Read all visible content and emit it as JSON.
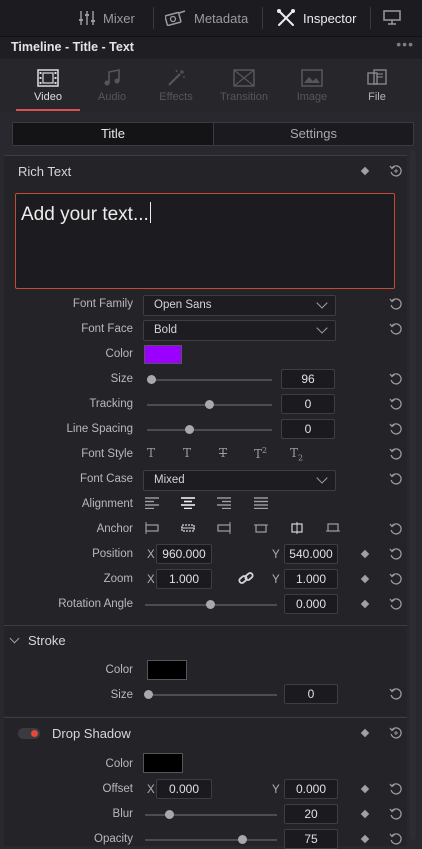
{
  "topbar": {
    "mixer": "Mixer",
    "metadata": "Metadata",
    "inspector": "Inspector"
  },
  "titlebar": {
    "title": "Timeline - Title - Text",
    "menu": "•••"
  },
  "tabs": [
    {
      "label": "Video",
      "icon": "film-icon",
      "active": true
    },
    {
      "label": "Audio",
      "icon": "music-icon",
      "active": false
    },
    {
      "label": "Effects",
      "icon": "magic-wand-icon",
      "active": false
    },
    {
      "label": "Transition",
      "icon": "transition-icon",
      "active": false
    },
    {
      "label": "Image",
      "icon": "image-icon",
      "active": false
    },
    {
      "label": "File",
      "icon": "file-icon",
      "active": false
    }
  ],
  "subtabs": {
    "title": "Title",
    "settings": "Settings"
  },
  "rich_text": {
    "heading": "Rich Text",
    "text_placeholder": "Add your text...",
    "font_family_label": "Font Family",
    "font_family_value": "Open Sans",
    "font_face_label": "Font Face",
    "font_face_value": "Bold",
    "color_label": "Color",
    "color_value": "#9b00ff",
    "size_label": "Size",
    "size_value": "96",
    "tracking_label": "Tracking",
    "tracking_value": "0",
    "line_spacing_label": "Line Spacing",
    "line_spacing_value": "0",
    "font_style_label": "Font Style",
    "font_style_glyphs": [
      "T",
      "T",
      "T",
      "T",
      "T"
    ],
    "font_style_sup": "2",
    "font_style_sub": "2",
    "font_case_label": "Font Case",
    "font_case_value": "Mixed",
    "alignment_label": "Alignment",
    "anchor_label": "Anchor",
    "position_label": "Position",
    "position_x": "960.000",
    "position_y": "540.000",
    "zoom_label": "Zoom",
    "zoom_x": "1.000",
    "zoom_y": "1.000",
    "rotation_label": "Rotation Angle",
    "rotation_value": "0.000",
    "axis_x": "X",
    "axis_y": "Y"
  },
  "stroke": {
    "heading": "Stroke",
    "color_label": "Color",
    "color_value": "#000000",
    "size_label": "Size",
    "size_value": "0"
  },
  "drop_shadow": {
    "heading": "Drop Shadow",
    "color_label": "Color",
    "color_value": "#000000",
    "offset_label": "Offset",
    "offset_x": "0.000",
    "offset_y": "0.000",
    "blur_label": "Blur",
    "blur_value": "20",
    "opacity_label": "Opacity",
    "opacity_value": "75"
  },
  "colors": {
    "accent": "#d9534f",
    "background": "#28282e"
  }
}
